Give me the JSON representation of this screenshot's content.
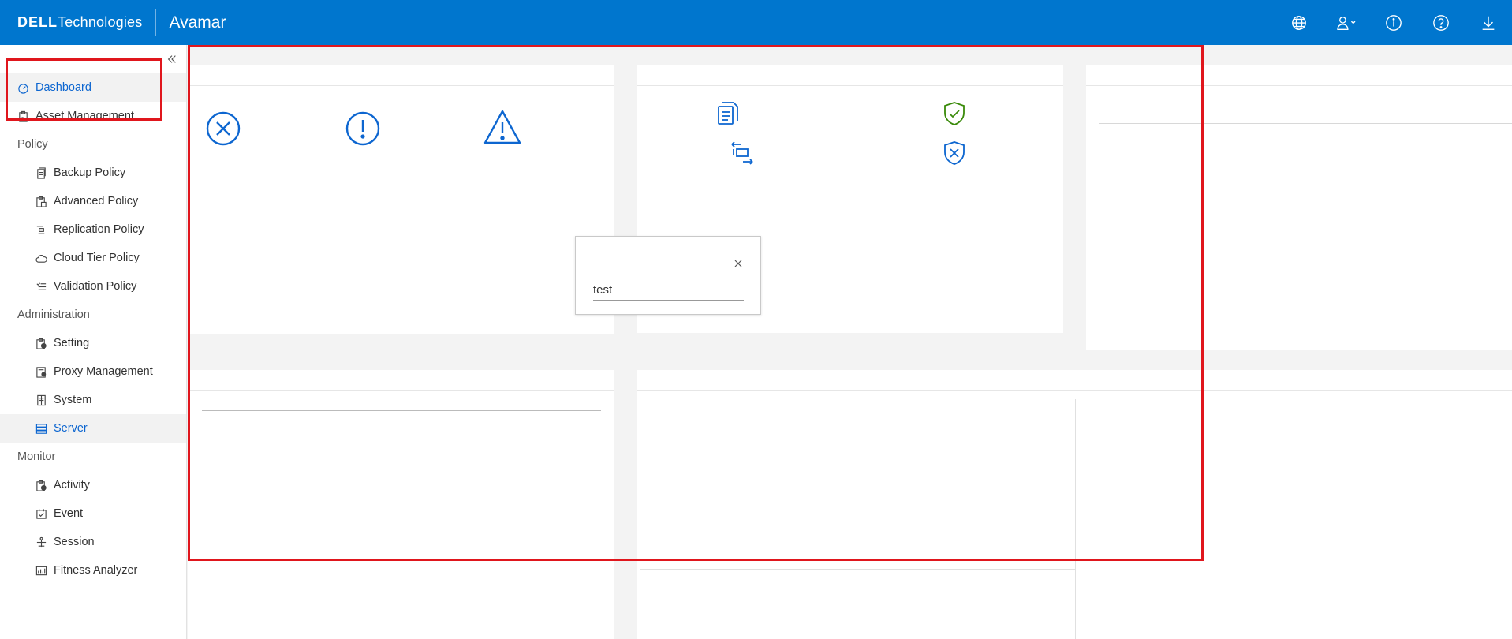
{
  "header": {
    "brand_bold": "DELL",
    "brand_rest": "Technologies",
    "app_name": "Avamar",
    "icons": [
      "globe-icon",
      "user-icon",
      "info-icon",
      "help-icon",
      "download-icon"
    ]
  },
  "sidebar": {
    "top_items": [
      {
        "label": "Dashboard",
        "icon": "dashboard-icon",
        "active": true
      },
      {
        "label": "Asset Management",
        "icon": "clipboard-icon"
      }
    ],
    "sections": [
      {
        "title": "Policy",
        "items": [
          {
            "label": "Backup Policy",
            "icon": "doc-icon"
          },
          {
            "label": "Advanced Policy",
            "icon": "advanced-doc-icon"
          },
          {
            "label": "Replication Policy",
            "icon": "replication-icon"
          },
          {
            "label": "Cloud Tier Policy",
            "icon": "cloud-icon"
          },
          {
            "label": "Validation Policy",
            "icon": "checklist-icon"
          }
        ]
      },
      {
        "title": "Administration",
        "items": [
          {
            "label": "Setting",
            "icon": "settings-icon"
          },
          {
            "label": "Proxy Management",
            "icon": "proxy-icon"
          },
          {
            "label": "System",
            "icon": "system-icon"
          },
          {
            "label": "Server",
            "icon": "server-icon",
            "active": true
          }
        ]
      },
      {
        "title": "Monitor",
        "items": [
          {
            "label": "Activity",
            "icon": "activity-icon"
          },
          {
            "label": "Event",
            "icon": "event-icon"
          },
          {
            "label": "Session",
            "icon": "session-icon"
          },
          {
            "label": "Fitness Analyzer",
            "icon": "chart-icon"
          }
        ]
      }
    ]
  },
  "popup": {
    "value": "test"
  },
  "colors": {
    "header": "#0076ce",
    "accent": "#0d66d0",
    "success": "#3a8a0a",
    "annotation": "#e0161d"
  }
}
